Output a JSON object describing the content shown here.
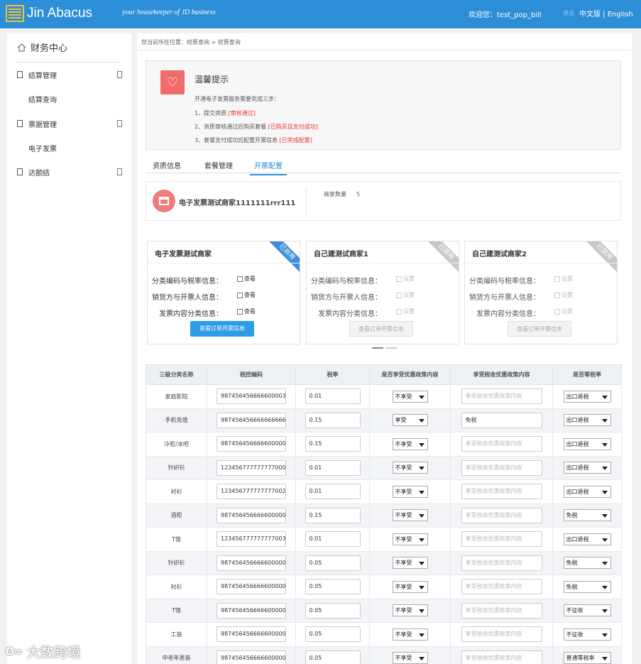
{
  "header": {
    "logo_text": "Jin Abacus",
    "slogan": "your housekeeper of JD business",
    "welcome": "欢迎您：test_pop_bill",
    "logout": "退出",
    "lang": "中文版 | English",
    "bg_color": "#2d8ed8"
  },
  "sidebar": {
    "title": "财务中心",
    "items": [
      {
        "label": "结算管理"
      },
      {
        "label": "票据管理"
      },
      {
        "label": "达额结"
      }
    ],
    "subs": [
      "结算查询",
      "电子发票"
    ]
  },
  "breadcrumb": "您当前所在位置：结算查询 > 结算查询",
  "tip": {
    "title": "温馨提示",
    "intro": "开通电子发票服务需要完成三步：",
    "steps": [
      {
        "text": "1、提交资质",
        "status": "[审核通过]"
      },
      {
        "text": "2、资质审核通过后购买套餐",
        "status": "[已购买且支付成功]"
      },
      {
        "text": "3、套餐支付成功后配置开票信息",
        "status": "[已完成配置]"
      }
    ]
  },
  "tabs": [
    "资质信息",
    "套餐管理",
    "开票配置"
  ],
  "active_tab": "开票配置",
  "merchant": {
    "name": "电子发票测试商家1111111rrr111",
    "count_label": "商家数量",
    "count": "5"
  },
  "cards": [
    {
      "title": "电子发票测试商家",
      "badge": "已启用",
      "enabled": true,
      "check_label": "查看",
      "button": "查看订单开票信息"
    },
    {
      "title": "自己建测试商家1",
      "badge": "已禁用",
      "enabled": false,
      "check_label": "设置",
      "button": "查看订单开票信息"
    },
    {
      "title": "自己建测试商家2",
      "badge": "已禁用",
      "enabled": false,
      "check_label": "设置",
      "button": "查看订单开票信息"
    }
  ],
  "card_rows": [
    "分类编码与税率信息：",
    "销货方与开票人信息：",
    "发票内容分类信息："
  ],
  "table": {
    "headers": [
      "三级分类名称",
      "税控编码",
      "税率",
      "是否享受优惠政策内容",
      "享受税收优惠政策内容",
      "是否零税率"
    ],
    "policy_placeholder": "享受税收优惠政策内容",
    "rows": [
      {
        "name": "家庭影院",
        "code": "987456456666600003",
        "rate": "0.01",
        "pref": "不享受",
        "policy": "",
        "zero": "出口退税"
      },
      {
        "name": "手机充值",
        "code": "987456456666666666",
        "rate": "0.15",
        "pref": "享受",
        "policy": "免税",
        "zero": "出口退税"
      },
      {
        "name": "冷柜/冰吧",
        "code": "987456456666600000",
        "rate": "0.15",
        "pref": "不享受",
        "policy": "",
        "zero": "出口退税"
      },
      {
        "name": "针织衫",
        "code": "123456777777777000",
        "rate": "0.01",
        "pref": "不享受",
        "policy": "",
        "zero": "出口退税"
      },
      {
        "name": "衬衫",
        "code": "123456777777777002",
        "rate": "0.01",
        "pref": "不享受",
        "policy": "",
        "zero": "出口退税"
      },
      {
        "name": "酒柜",
        "code": "987456456666600000",
        "rate": "0.15",
        "pref": "不享受",
        "policy": "",
        "zero": "免税"
      },
      {
        "name": "T恤",
        "code": "123456777777777003",
        "rate": "0.01",
        "pref": "不享受",
        "policy": "",
        "zero": "出口退税"
      },
      {
        "name": "针织衫",
        "code": "987456456666600000",
        "rate": "0.05",
        "pref": "不享受",
        "policy": "",
        "zero": "免税"
      },
      {
        "name": "衬衫",
        "code": "987456456666600000",
        "rate": "0.05",
        "pref": "不享受",
        "policy": "",
        "zero": "免税"
      },
      {
        "name": "T恤",
        "code": "987456456666600000",
        "rate": "0.05",
        "pref": "不享受",
        "policy": "",
        "zero": "不征收"
      },
      {
        "name": "工装",
        "code": "987456456666600000",
        "rate": "0.05",
        "pref": "不享受",
        "policy": "",
        "zero": "不征收"
      },
      {
        "name": "中老年男装",
        "code": "987456456666600000",
        "rate": "0.05",
        "pref": "不享受",
        "policy": "",
        "zero": "普通零税率"
      }
    ]
  },
  "watermark": "大数跨境"
}
